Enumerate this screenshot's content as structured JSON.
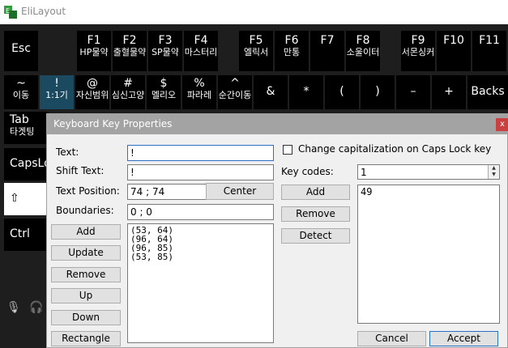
{
  "window": {
    "title": "EliLayout"
  },
  "keyboard": {
    "row1": [
      {
        "p": "Esc",
        "s": ""
      },
      {
        "p": "F1",
        "s": "HP물약"
      },
      {
        "p": "F2",
        "s": "출혈물약"
      },
      {
        "p": "F3",
        "s": "SP물약"
      },
      {
        "p": "F4",
        "s": "마스터리"
      },
      {
        "p": "F5",
        "s": "엘릭서"
      },
      {
        "p": "F6",
        "s": "만통"
      },
      {
        "p": "F7",
        "s": ""
      },
      {
        "p": "F8",
        "s": "소울이터"
      },
      {
        "p": "F9",
        "s": "서몬싱커"
      },
      {
        "p": "F10",
        "s": ""
      },
      {
        "p": "F11",
        "s": ""
      }
    ],
    "row2": [
      {
        "p": "~",
        "s": "이동"
      },
      {
        "p": "!",
        "s": "1:1기"
      },
      {
        "p": "@",
        "s": "자신범위"
      },
      {
        "p": "#",
        "s": "심신고양"
      },
      {
        "p": "$",
        "s": "멜리오"
      },
      {
        "p": "%",
        "s": "파라레"
      },
      {
        "p": "^",
        "s": "순간이동"
      },
      {
        "p": "&",
        "s": ""
      },
      {
        "p": "*",
        "s": ""
      },
      {
        "p": "(",
        "s": ""
      },
      {
        "p": ")",
        "s": ""
      },
      {
        "p": "–",
        "s": ""
      },
      {
        "p": "+",
        "s": ""
      },
      {
        "p": "Backs",
        "s": ""
      }
    ],
    "left_col": [
      {
        "p": "Tab",
        "s": "타겟팅"
      },
      {
        "p": "CapsLo",
        "s": ""
      },
      {
        "p": "⇧",
        "s": ""
      },
      {
        "p": "Ctrl",
        "s": ""
      }
    ]
  },
  "dialog": {
    "title": "Keyboard Key Properties",
    "close": "x",
    "text_label": "Text:",
    "text_value": "!",
    "shift_label": "Shift Text:",
    "shift_value": "!",
    "position_label": "Text Position:",
    "position_value": "74 ; 74",
    "center_button": "Center",
    "boundaries_label": "Boundaries:",
    "boundaries_value": "0 ; 0",
    "caps_label": "Change capitalization on Caps Lock key",
    "keycodes_label": "Key codes:",
    "keycode_value": "1",
    "keycode_list": [
      "49"
    ],
    "points": [
      "(53, 64)",
      "(96, 64)",
      "(96, 85)",
      "(53, 85)"
    ],
    "left_buttons": [
      "Add",
      "Update",
      "Remove",
      "Up",
      "Down",
      "Rectangle"
    ],
    "mid_buttons": [
      "Add",
      "Remove",
      "Detect"
    ],
    "cancel": "Cancel",
    "accept": "Accept"
  }
}
